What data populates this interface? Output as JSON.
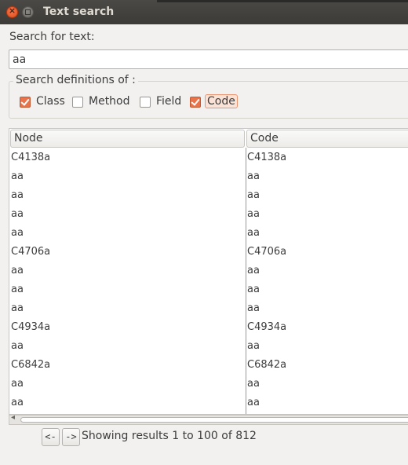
{
  "window": {
    "title": "Text search"
  },
  "search": {
    "label": "Search for text:",
    "value": "aa"
  },
  "definitions": {
    "legend": "Search definitions of :",
    "options": [
      {
        "label": "Class",
        "checked": true
      },
      {
        "label": "Method",
        "checked": false
      },
      {
        "label": "Field",
        "checked": false
      },
      {
        "label": "Code",
        "checked": true
      }
    ]
  },
  "results": {
    "columns": [
      "Node",
      "Code"
    ],
    "rows": [
      [
        "C4138a",
        "C4138a"
      ],
      [
        "aa",
        "aa"
      ],
      [
        "aa",
        "aa"
      ],
      [
        "aa",
        "aa"
      ],
      [
        "aa",
        "aa"
      ],
      [
        "C4706a",
        "C4706a"
      ],
      [
        "aa",
        "aa"
      ],
      [
        "aa",
        "aa"
      ],
      [
        "aa",
        "aa"
      ],
      [
        "C4934a",
        "C4934a"
      ],
      [
        "aa",
        "aa"
      ],
      [
        "C6842a",
        "C6842a"
      ],
      [
        "aa",
        "aa"
      ],
      [
        "aa",
        "aa"
      ]
    ]
  },
  "pager": {
    "prev_label": "<-",
    "next_label": "->",
    "status": "Showing results 1 to 100 of 812"
  }
}
